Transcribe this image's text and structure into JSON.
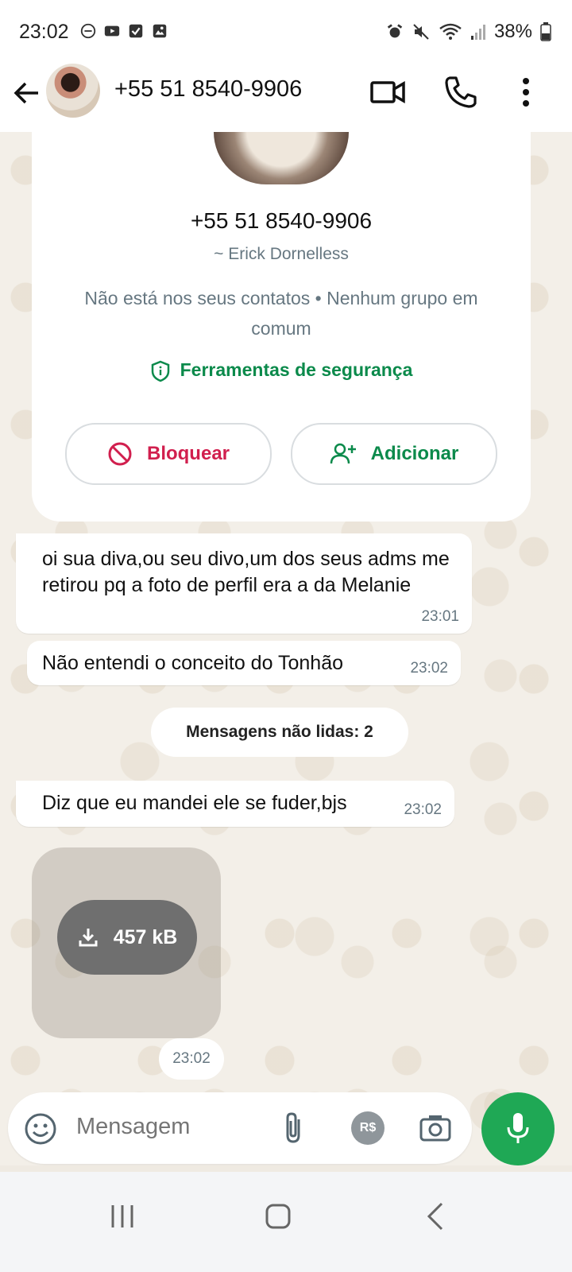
{
  "status": {
    "time": "23:02",
    "battery": "38%"
  },
  "header": {
    "title": "+55 51 8540-9906"
  },
  "contact_card": {
    "phone": "+55 51 8540-9906",
    "name": "~ Erick Dornelless",
    "info": "Não está nos seus contatos • Nenhum grupo em comum",
    "safety_tools": "Ferramentas de segurança",
    "block_label": "Bloquear",
    "add_label": "Adicionar"
  },
  "messages": [
    {
      "text": "oi sua diva,ou seu divo,um dos seus adms me retirou pq a foto de perfil era a da Melanie",
      "time": "23:01"
    },
    {
      "text": "Não entendi o conceito do Tonhão",
      "time": "23:02"
    },
    {
      "text": "Diz que eu mandei ele se fuder,bjs",
      "time": "23:02"
    }
  ],
  "unread_divider": "Mensagens não lidas: 2",
  "media": {
    "size": "457 kB",
    "time": "23:02"
  },
  "composer": {
    "placeholder": "Mensagem",
    "pay_label": "R$"
  },
  "colors": {
    "accent_green": "#1fa855",
    "block_red": "#d11f4e"
  }
}
